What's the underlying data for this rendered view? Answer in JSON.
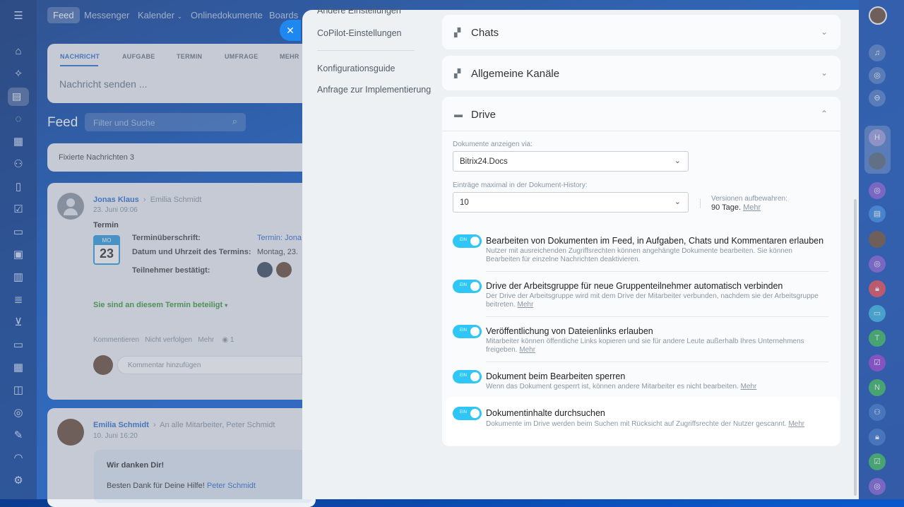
{
  "topbar": {
    "items": [
      "Feed",
      "Messenger",
      "Kalender",
      "Onlinedokumente",
      "Boards"
    ]
  },
  "post_form": {
    "tabs": [
      "NACHRICHT",
      "AUFGABE",
      "TERMIN",
      "UMFRAGE",
      "MEHR"
    ],
    "placeholder": "Nachricht senden ..."
  },
  "feed": {
    "title": "Feed",
    "filter_placeholder": "Filter und Suche",
    "pinned": "Fixierte Nachrichten",
    "pinned_count": "3",
    "post1": {
      "author": "Jonas Klaus",
      "recipient": "Emilia Schmidt",
      "date": "23. Juni 09:06",
      "type": "Termin",
      "cal_day": "MO",
      "cal_date": "23",
      "f1_label": "Terminüberschrift:",
      "f1_value": "Termin: Jona",
      "f2_label": "Datum und Uhrzeit des Termins:",
      "f2_value": "Montag, 23.",
      "f3_label": "Teilnehmer bestätigt:",
      "participating": "Sie sind an diesem Termin beteiligt",
      "actions": [
        "Kommentieren",
        "Nicht verfolgen",
        "Mehr"
      ],
      "views": "1",
      "comment_placeholder": "Kommentar hinzufügen"
    },
    "post2": {
      "author": "Emilia Schmidt",
      "recipient": "An alle Mitarbeiter, Peter Schmidt",
      "date": "10. Juni 16:20",
      "heading": "Wir danken Dir!",
      "text": "Besten Dank für Deine Hilfe!",
      "mention": "Peter Schmidt"
    }
  },
  "panel": {
    "menu": [
      "Andere Einstellungen",
      "CoPilot-Einstellungen",
      "Konfigurationsguide",
      "Anfrage zur Implementierung"
    ],
    "sections": [
      "Chats",
      "Allgemeine Kanäle",
      "Drive"
    ],
    "drive": {
      "docs_label": "Dokumente anzeigen via:",
      "docs_value": "Bitrix24.Docs",
      "history_label": "Einträge maximal in der Dokument-History:",
      "history_value": "10",
      "keep_label": "Versionen aufbewahren:",
      "keep_value": "90 Tage.",
      "more": "Mehr",
      "toggle_label": "EIN",
      "options": [
        {
          "title": "Bearbeiten von Dokumenten im Feed, in Aufgaben, Chats und Kommentaren erlauben",
          "desc": "Nutzer mit ausreichenden Zugriffsrechten können angehängte Dokumente bearbeiten. Sie können Bearbeiten für einzelne Nachrichten deaktivieren."
        },
        {
          "title": "Drive der Arbeitsgruppe für neue Gruppenteilnehmer automatisch verbinden",
          "desc": "Der Drive der Arbeitsgruppe wird mit dem Drive der Mitarbeiter verbunden, nachdem sie der Arbeitsgruppe beitreten."
        },
        {
          "title": "Veröffentlichung von Dateienlinks erlauben",
          "desc": "Mitarbeiter können öffentliche Links kopieren und sie für andere Leute außerhalb Ihres Unternehmens freigeben."
        },
        {
          "title": "Dokument beim Bearbeiten sperren",
          "desc": "Wenn das Dokument gesperrt ist, können andere Mitarbeiter es nicht bearbeiten."
        },
        {
          "title": "Dokumentinhalte durchsuchen",
          "desc": "Dokumente im Drive werden beim Suchen mit Rücksicht auf Zugriffsrechte der Nutzer gescannt."
        }
      ]
    }
  },
  "rightrail": {
    "letters": [
      "H",
      "T",
      "N"
    ]
  }
}
